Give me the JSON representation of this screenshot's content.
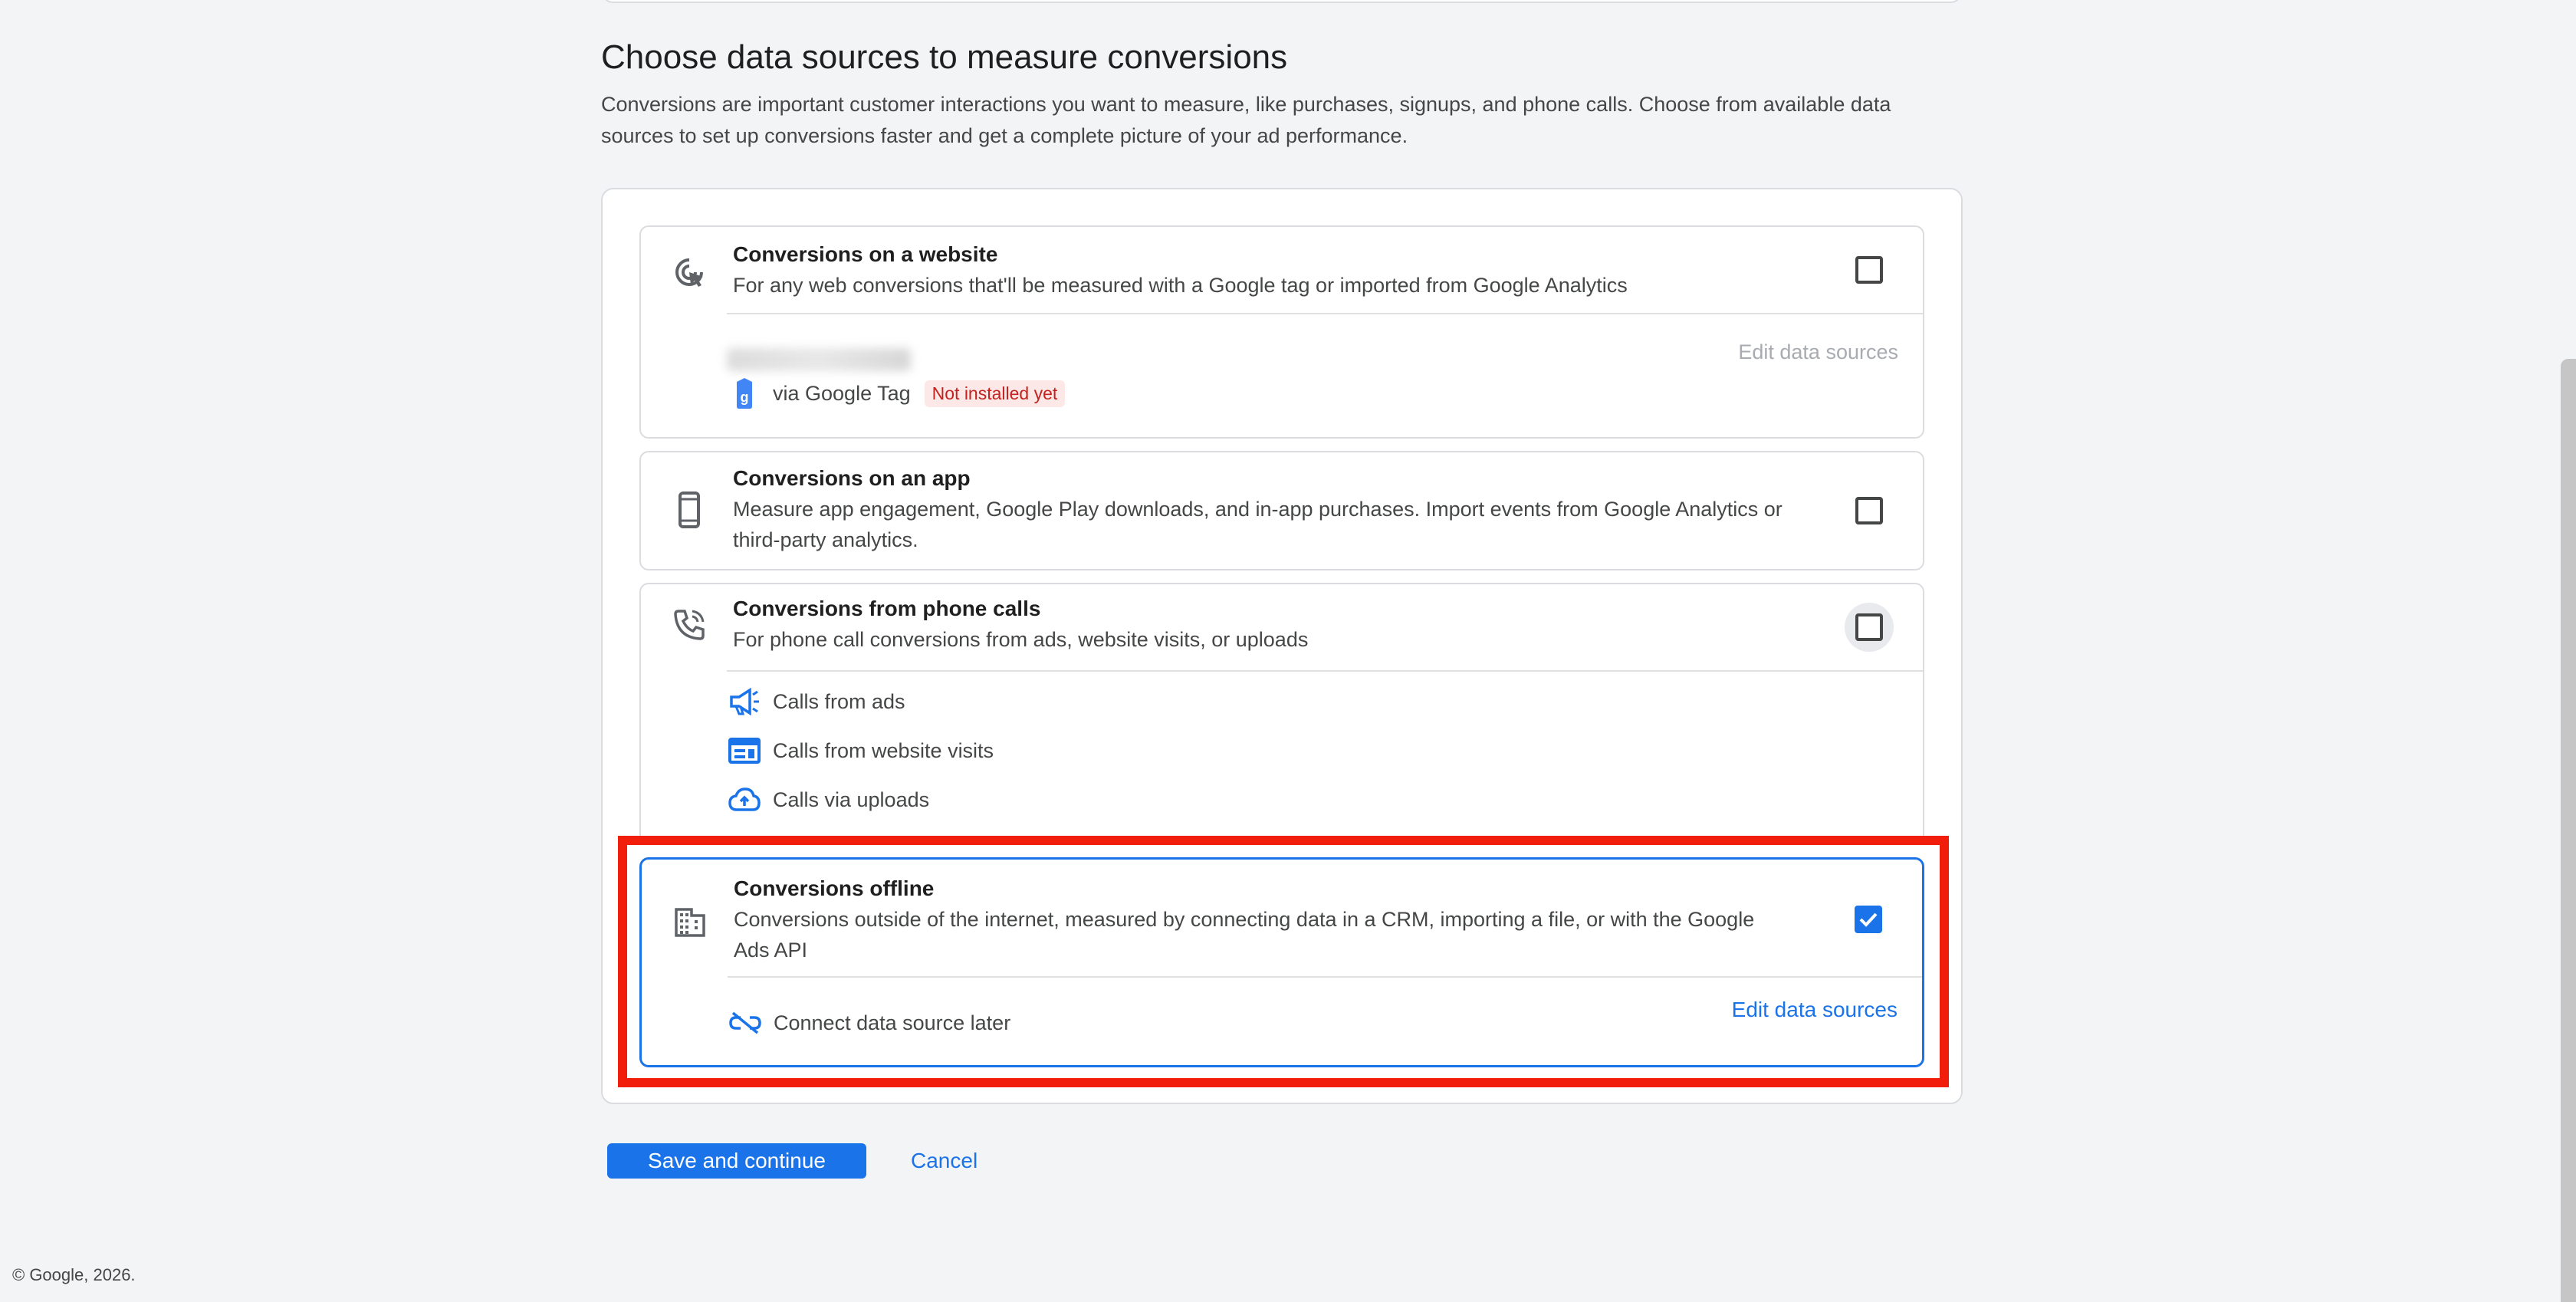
{
  "section": {
    "title": "Choose data sources to measure conversions",
    "description": "Conversions are important customer interactions you want to measure, like purchases, signups, and phone calls. Choose from available data sources to set up conversions faster and get a complete picture of your ad performance."
  },
  "options": {
    "website": {
      "title": "Conversions on a website",
      "subtitle": "For any web conversions that'll be measured with a Google tag or imported from Google Analytics",
      "edit_link": "Edit data sources",
      "source_label": "via Google Tag",
      "badge": "Not installed yet",
      "checked": false,
      "icon": "cursor-click-icon"
    },
    "app": {
      "title": "Conversions on an app",
      "subtitle": "Measure app engagement, Google Play downloads, and in-app purchases. Import events from Google Analytics or third-party analytics.",
      "checked": false,
      "icon": "smartphone-icon"
    },
    "phone": {
      "title": "Conversions from phone calls",
      "subtitle": "For phone call conversions from ads, website visits, or uploads",
      "checked": false,
      "icon": "phone-call-icon",
      "items": [
        {
          "label": "Calls from ads",
          "icon": "megaphone-icon"
        },
        {
          "label": "Calls from website visits",
          "icon": "web-icon"
        },
        {
          "label": "Calls via uploads",
          "icon": "cloud-upload-icon"
        }
      ]
    },
    "offline": {
      "title": "Conversions offline",
      "subtitle": "Conversions outside of the internet, measured by connecting data in a CRM, importing a file, or with the Google Ads API",
      "checked": true,
      "icon": "building-icon",
      "source_label": "Connect data source later",
      "edit_link": "Edit data sources"
    }
  },
  "actions": {
    "save_label": "Save and continue",
    "cancel_label": "Cancel"
  },
  "footer": {
    "copyright": "© Google, 2026."
  },
  "colors": {
    "accent": "#1a73e8",
    "highlight": "#f01e0a",
    "badge_bg": "#fce8e6",
    "badge_text": "#c5221f"
  }
}
